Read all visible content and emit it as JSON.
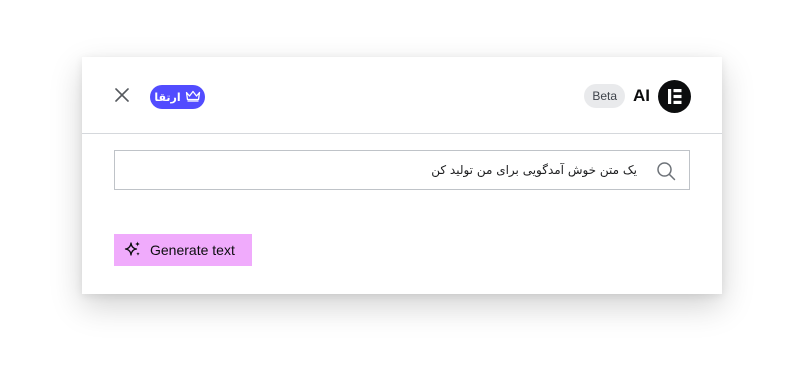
{
  "header": {
    "close_icon": "close-icon",
    "upgrade_label": "ارتقا",
    "upgrade_icon": "crown-icon",
    "beta_label": "Beta",
    "title": "AI",
    "logo_icon": "elementor-logo-icon"
  },
  "prompt": {
    "value": "یک متن خوش آمدگویی برای من تولید کن",
    "icon": "search-icon"
  },
  "actions": {
    "generate_label": "Generate text",
    "generate_icon": "sparkles-icon"
  },
  "colors": {
    "upgrade_bg": "#524cff",
    "generate_bg": "#f0abfc",
    "logo_bg": "#0c0d0e"
  }
}
